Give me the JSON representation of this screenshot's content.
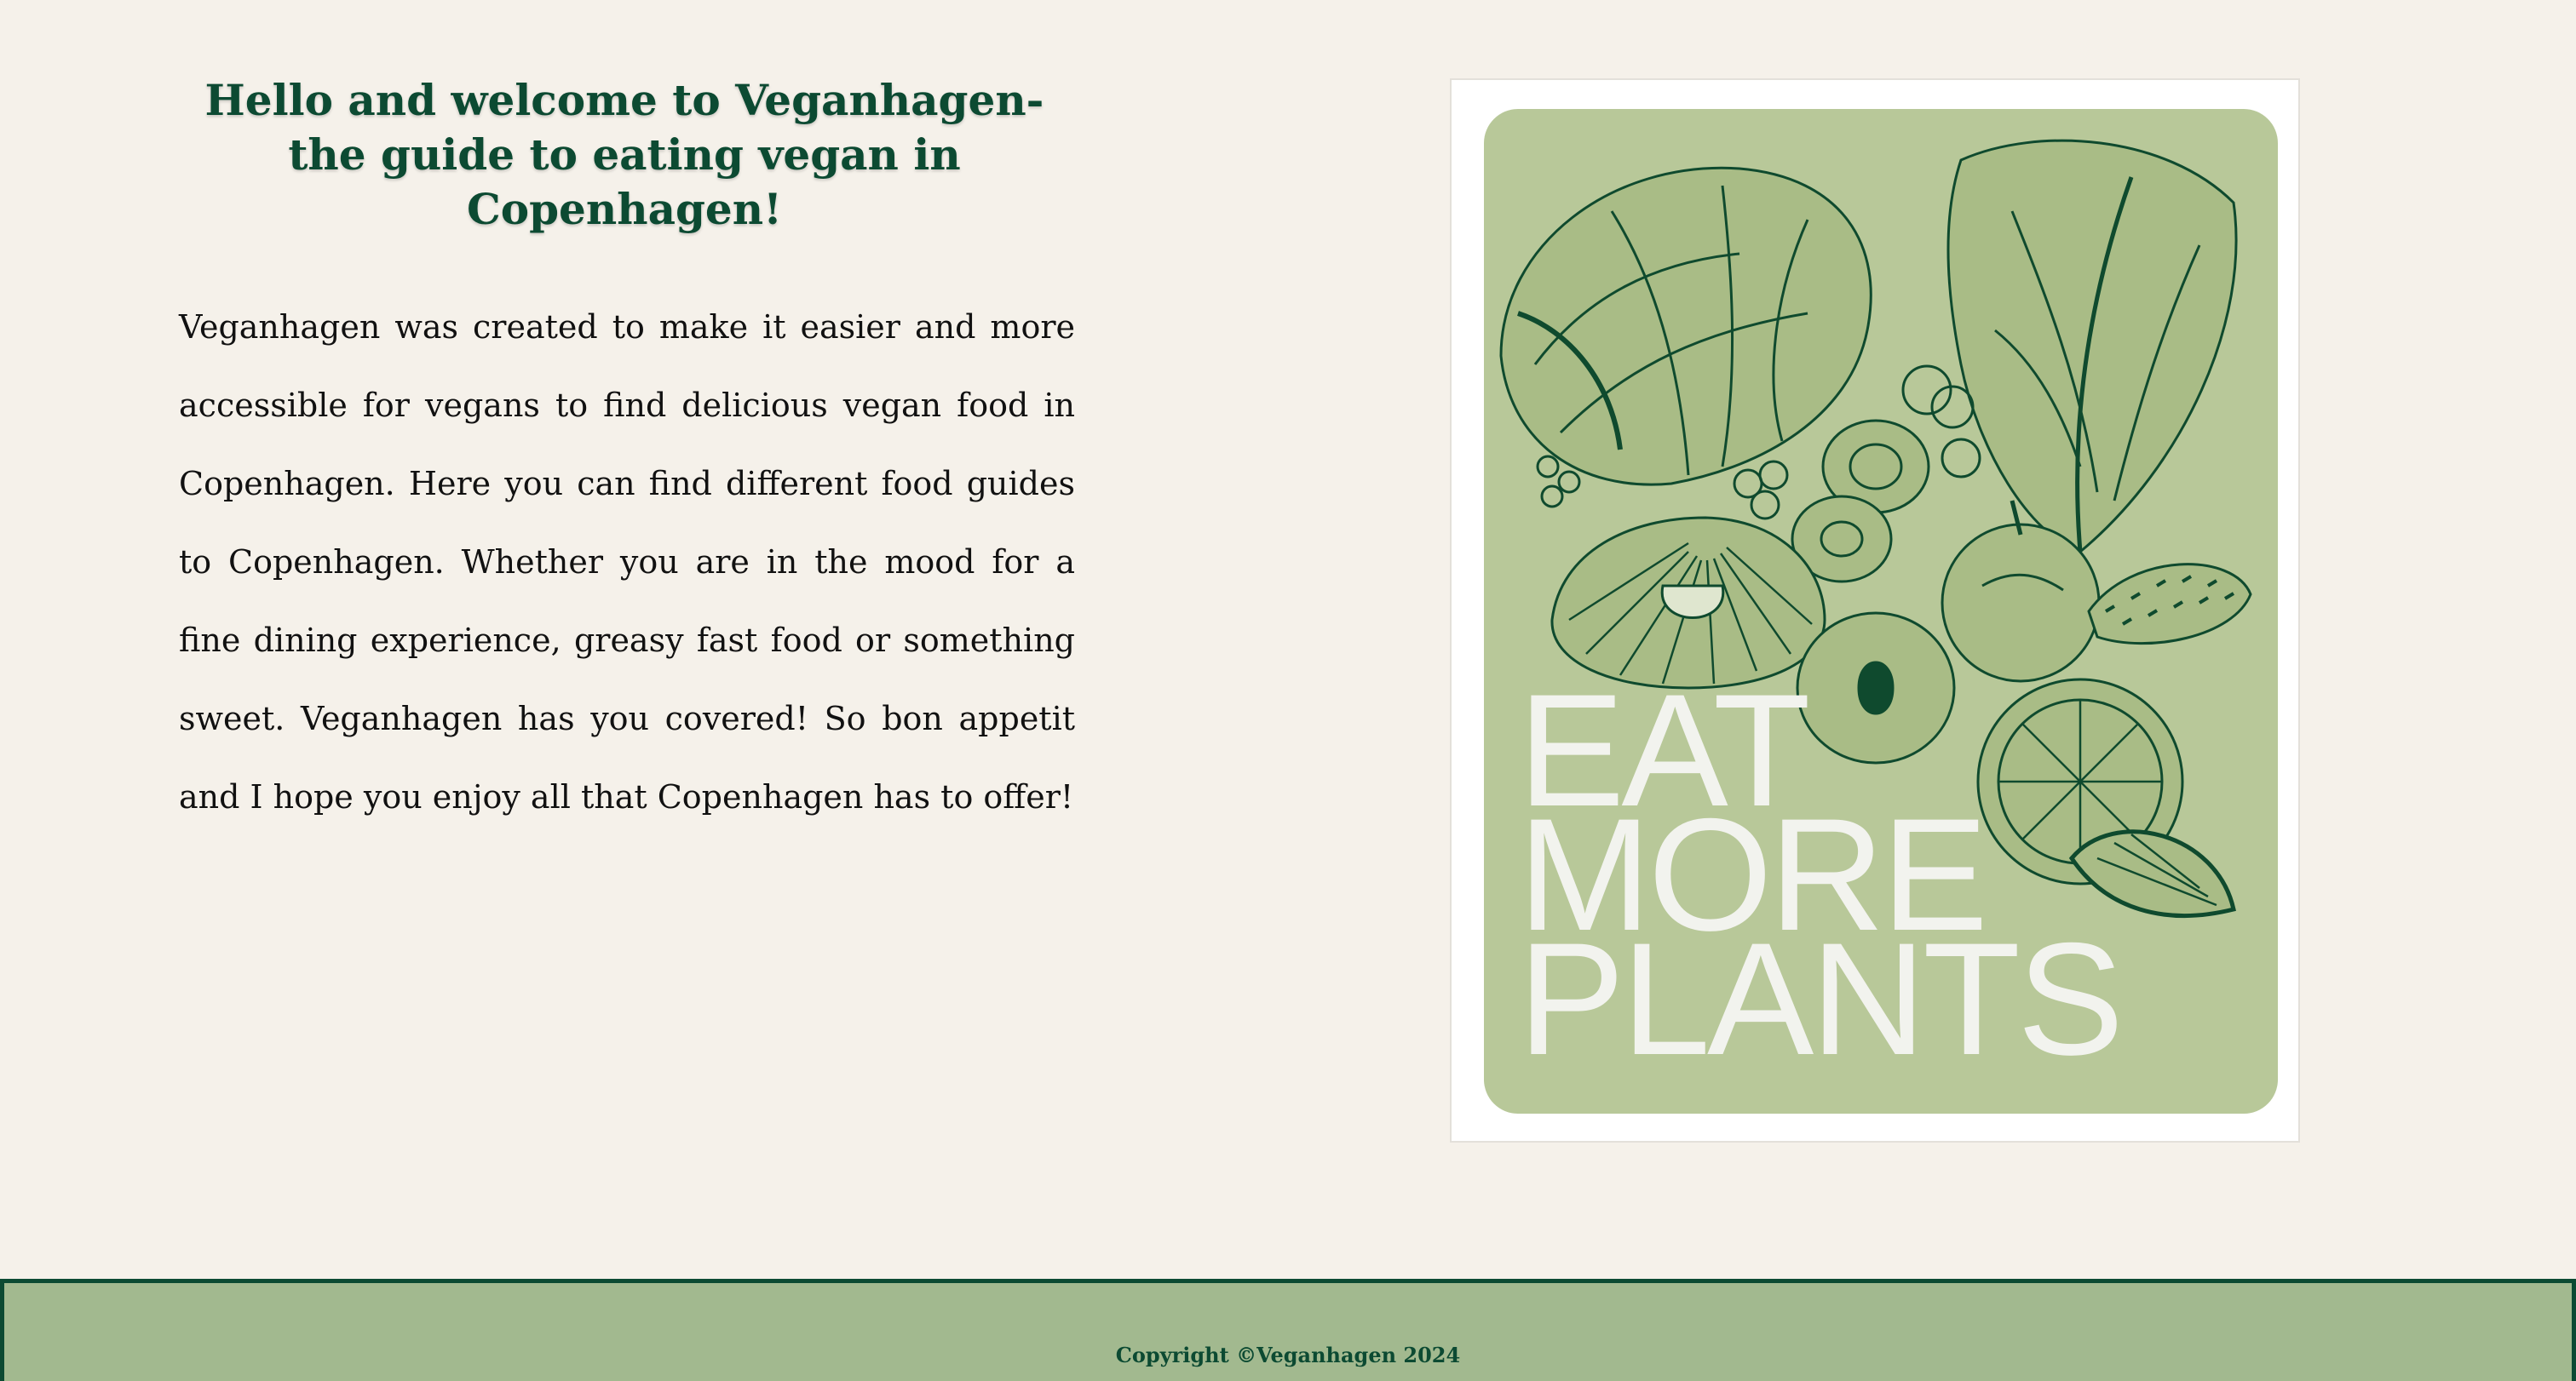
{
  "intro": {
    "heading": "Hello and welcome to Veganhagen- the guide to eating vegan in Copenhagen!",
    "body": "Veganhagen was created to make it easier and more accessible for vegans to find delicious vegan food in Copenhagen. Here you can find different food guides to Copenhagen. Whether you are in the mood for a fine dining experience, greasy fast food or something sweet. Veganhagen has you covered! So bon appetit and I hope you enjoy all that Copenhagen has to offer!"
  },
  "poster": {
    "line1": "EAT",
    "line2": "MORE",
    "line3": "PLANTS"
  },
  "footer": {
    "copyright": "Copyright ©Veganhagen 2024"
  },
  "colors": {
    "page_background": "#f5f1ea",
    "brand_green": "#0c4a32",
    "footer_background": "#a2b98f",
    "poster_background": "#b8c899"
  }
}
